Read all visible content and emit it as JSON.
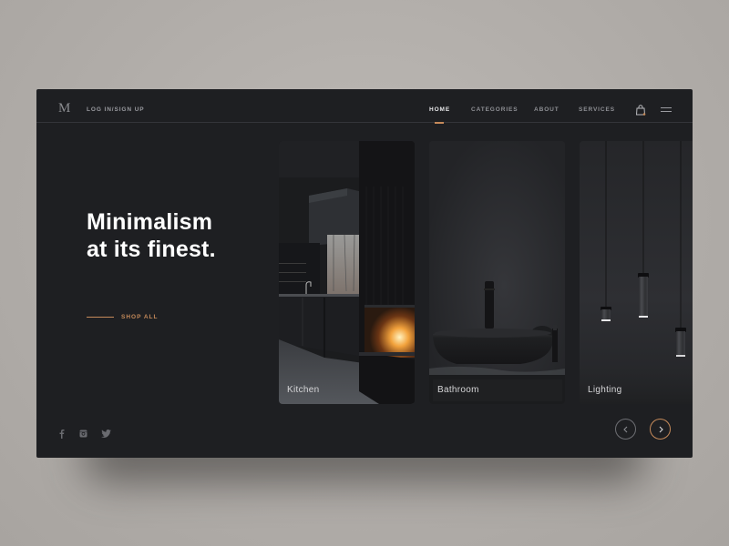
{
  "header": {
    "logo": "M",
    "login_label": "LOG IN/SIGN UP",
    "nav": [
      {
        "label": "HOME",
        "active": true
      },
      {
        "label": "CATEGORIES",
        "active": false
      },
      {
        "label": "ABOUT",
        "active": false
      },
      {
        "label": "SERVICES",
        "active": false
      }
    ],
    "icons": [
      "shopping-bag-icon",
      "hamburger-menu-icon"
    ]
  },
  "hero": {
    "title": "Minimalism\nat its finest.",
    "cta_label": "SHOP ALL"
  },
  "categories": [
    {
      "label": "Kitchen"
    },
    {
      "label": "Bathroom"
    },
    {
      "label": "Lighting"
    }
  ],
  "social": [
    "facebook-icon",
    "instagram-icon",
    "twitter-icon"
  ],
  "carousel": {
    "prev": "chevron-left-icon",
    "next": "chevron-right-icon"
  },
  "colors": {
    "accent": "#c58a5a",
    "background": "#1e1f22",
    "page": "#b0aca8",
    "text": "#ffffff"
  }
}
